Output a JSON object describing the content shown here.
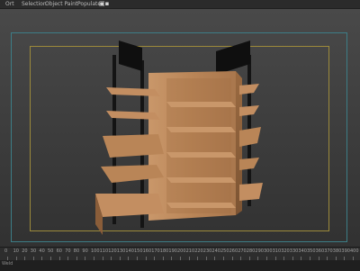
{
  "topbar": {
    "items": [
      "Ort",
      "Selection",
      "Object Paint",
      "Populate"
    ],
    "icon": "toolbar-icon",
    "icon_glyph": "▣▪"
  },
  "timeline": {
    "ticks": [
      "0",
      "10",
      "20",
      "30",
      "40",
      "50",
      "60",
      "70",
      "80",
      "90",
      "100",
      "110",
      "120",
      "130",
      "140",
      "150",
      "160",
      "170",
      "180",
      "190",
      "200",
      "210",
      "220",
      "230",
      "240",
      "250",
      "260",
      "270",
      "280",
      "290",
      "300",
      "310",
      "320",
      "330",
      "340",
      "350",
      "360",
      "370",
      "380",
      "390",
      "400"
    ],
    "status_left": "Weld"
  },
  "colors": {
    "viewport_frame_outer": "#3c7d86",
    "viewport_frame_inner": "#9c8a3b",
    "wood": "#b8865b",
    "wood_dark": "#8a5d39",
    "metal": "#151515"
  }
}
